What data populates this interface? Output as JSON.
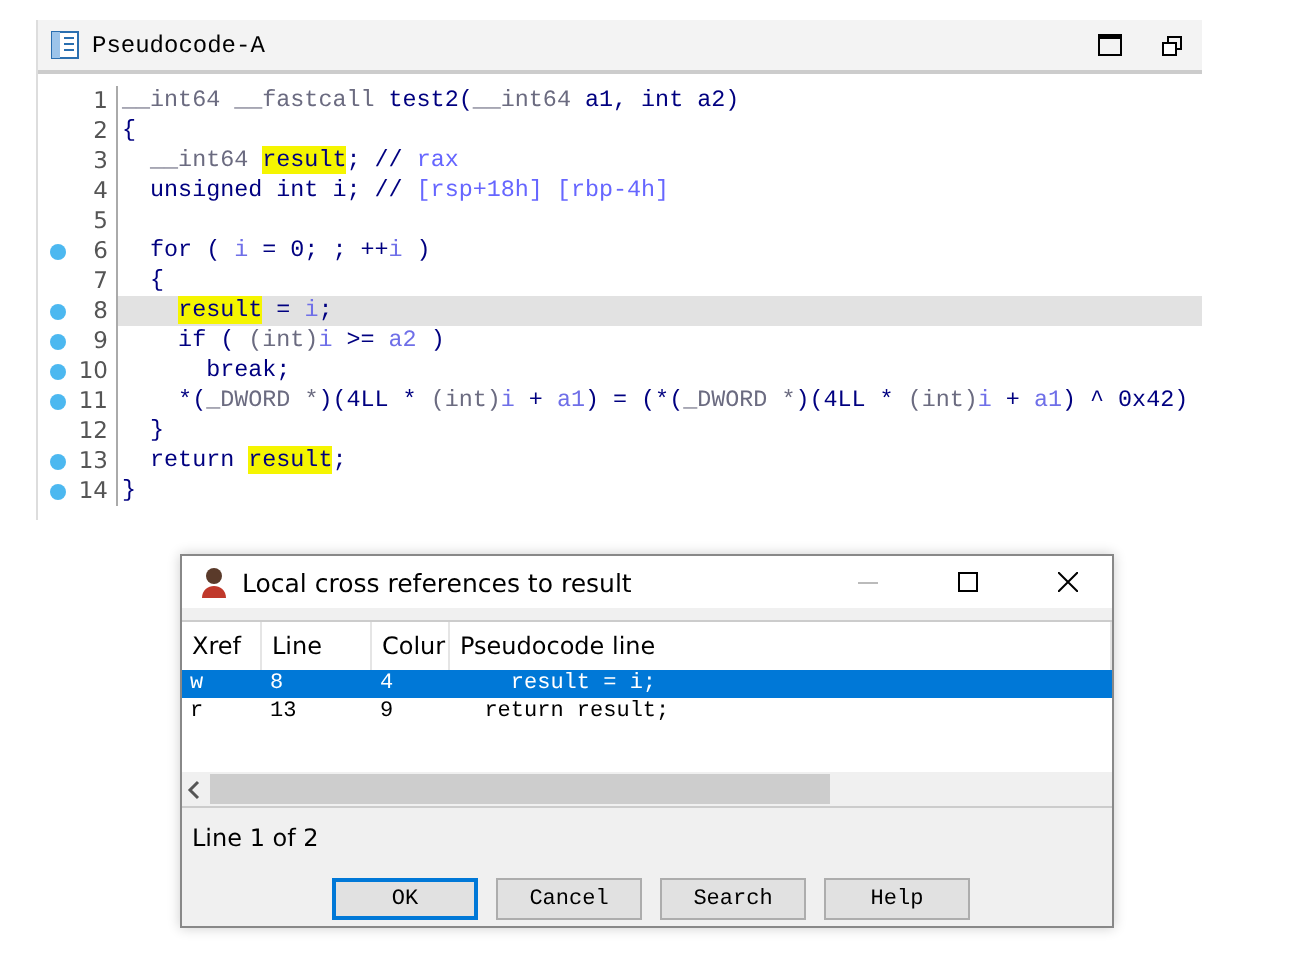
{
  "editor": {
    "title": "Pseudocode-A",
    "lines": [
      {
        "number": "1",
        "breakpoint": false,
        "selected": false,
        "tokens": [
          {
            "kind": "type",
            "text": "__int64 __fastcall "
          },
          {
            "kind": "plain",
            "text": "test2("
          },
          {
            "kind": "type",
            "text": "__int64"
          },
          {
            "kind": "plain",
            "text": " a1, int a2)"
          }
        ]
      },
      {
        "number": "2",
        "breakpoint": false,
        "selected": false,
        "tokens": [
          {
            "kind": "plain",
            "text": "{"
          }
        ]
      },
      {
        "number": "3",
        "breakpoint": false,
        "selected": false,
        "tokens": [
          {
            "kind": "type",
            "text": "  __int64 "
          },
          {
            "kind": "hl",
            "text": "result"
          },
          {
            "kind": "plain",
            "text": "; // "
          },
          {
            "kind": "comment",
            "text": "rax"
          }
        ]
      },
      {
        "number": "4",
        "breakpoint": false,
        "selected": false,
        "tokens": [
          {
            "kind": "plain",
            "text": "  unsigned int i; // "
          },
          {
            "kind": "comment",
            "text": "[rsp+18h] [rbp-4h]"
          }
        ]
      },
      {
        "number": "5",
        "breakpoint": false,
        "selected": false
      },
      {
        "number": "6",
        "breakpoint": true,
        "selected": false,
        "tokens": [
          {
            "kind": "plain",
            "text": "  for ( "
          },
          {
            "kind": "var",
            "text": "i"
          },
          {
            "kind": "plain",
            "text": " = 0; ; ++"
          },
          {
            "kind": "var",
            "text": "i"
          },
          {
            "kind": "plain",
            "text": " )"
          }
        ]
      },
      {
        "number": "7",
        "breakpoint": false,
        "selected": false,
        "tokens": [
          {
            "kind": "plain",
            "text": "  {"
          }
        ]
      },
      {
        "number": "8",
        "breakpoint": true,
        "selected": true,
        "tokens": [
          {
            "kind": "hl",
            "text": "    result"
          },
          {
            "kind": "plain",
            "text": " = "
          },
          {
            "kind": "var",
            "text": "i"
          },
          {
            "kind": "plain",
            "text": ";"
          }
        ]
      },
      {
        "number": "9",
        "breakpoint": true,
        "selected": false,
        "tokens": [
          {
            "kind": "plain",
            "text": "    if ( "
          },
          {
            "kind": "type",
            "text": "(int)"
          },
          {
            "kind": "var",
            "text": "i"
          },
          {
            "kind": "plain",
            "text": " >= "
          },
          {
            "kind": "var",
            "text": "a2"
          },
          {
            "kind": "plain",
            "text": " )"
          }
        ]
      },
      {
        "number": "10",
        "breakpoint": true,
        "selected": false,
        "tokens": [
          {
            "kind": "plain",
            "text": "      break;"
          }
        ]
      },
      {
        "number": "11",
        "breakpoint": true,
        "selected": false,
        "tokens": [
          {
            "kind": "plain",
            "text": "    *("
          },
          {
            "kind": "type",
            "text": "_DWORD *"
          },
          {
            "kind": "plain",
            "text": ")(4LL * "
          },
          {
            "kind": "type",
            "text": "(int)"
          },
          {
            "kind": "var",
            "text": "i"
          },
          {
            "kind": "plain",
            "text": " + "
          },
          {
            "kind": "var",
            "text": "a1"
          },
          {
            "kind": "plain",
            "text": ") = (*("
          },
          {
            "kind": "type",
            "text": "_DWORD *"
          },
          {
            "kind": "plain",
            "text": ")(4LL * "
          },
          {
            "kind": "type",
            "text": "(int)"
          },
          {
            "kind": "var",
            "text": "i"
          },
          {
            "kind": "plain",
            "text": " + "
          },
          {
            "kind": "var",
            "text": "a1"
          },
          {
            "kind": "plain",
            "text": ") ^ 0x42)"
          }
        ]
      },
      {
        "number": "12",
        "breakpoint": false,
        "selected": false,
        "tokens": [
          {
            "kind": "plain",
            "text": "  }"
          }
        ]
      },
      {
        "number": "13",
        "breakpoint": true,
        "selected": false,
        "tokens": [
          {
            "kind": "plain",
            "text": "  return "
          },
          {
            "kind": "hl",
            "text": "result"
          },
          {
            "kind": "plain",
            "text": ";"
          }
        ]
      },
      {
        "number": "14",
        "breakpoint": true,
        "selected": false,
        "tokens": [
          {
            "kind": "plain",
            "text": "}"
          }
        ]
      }
    ]
  },
  "dialog": {
    "title": "Local cross references to result",
    "columns": [
      "Xref",
      "Line",
      "Colur",
      "Pseudocode line"
    ],
    "rows": [
      {
        "xref": "w",
        "line": "8",
        "column": "4",
        "code": "    result = i;",
        "selected": true
      },
      {
        "xref": "r",
        "line": "13",
        "column": "9",
        "code": "  return result;",
        "selected": false
      }
    ],
    "status": "Line 1 of 2",
    "buttons": [
      {
        "label": "OK",
        "focused": true
      },
      {
        "label": "Cancel",
        "focused": false
      },
      {
        "label": "Search",
        "focused": false
      },
      {
        "label": "Help",
        "focused": false
      }
    ]
  }
}
